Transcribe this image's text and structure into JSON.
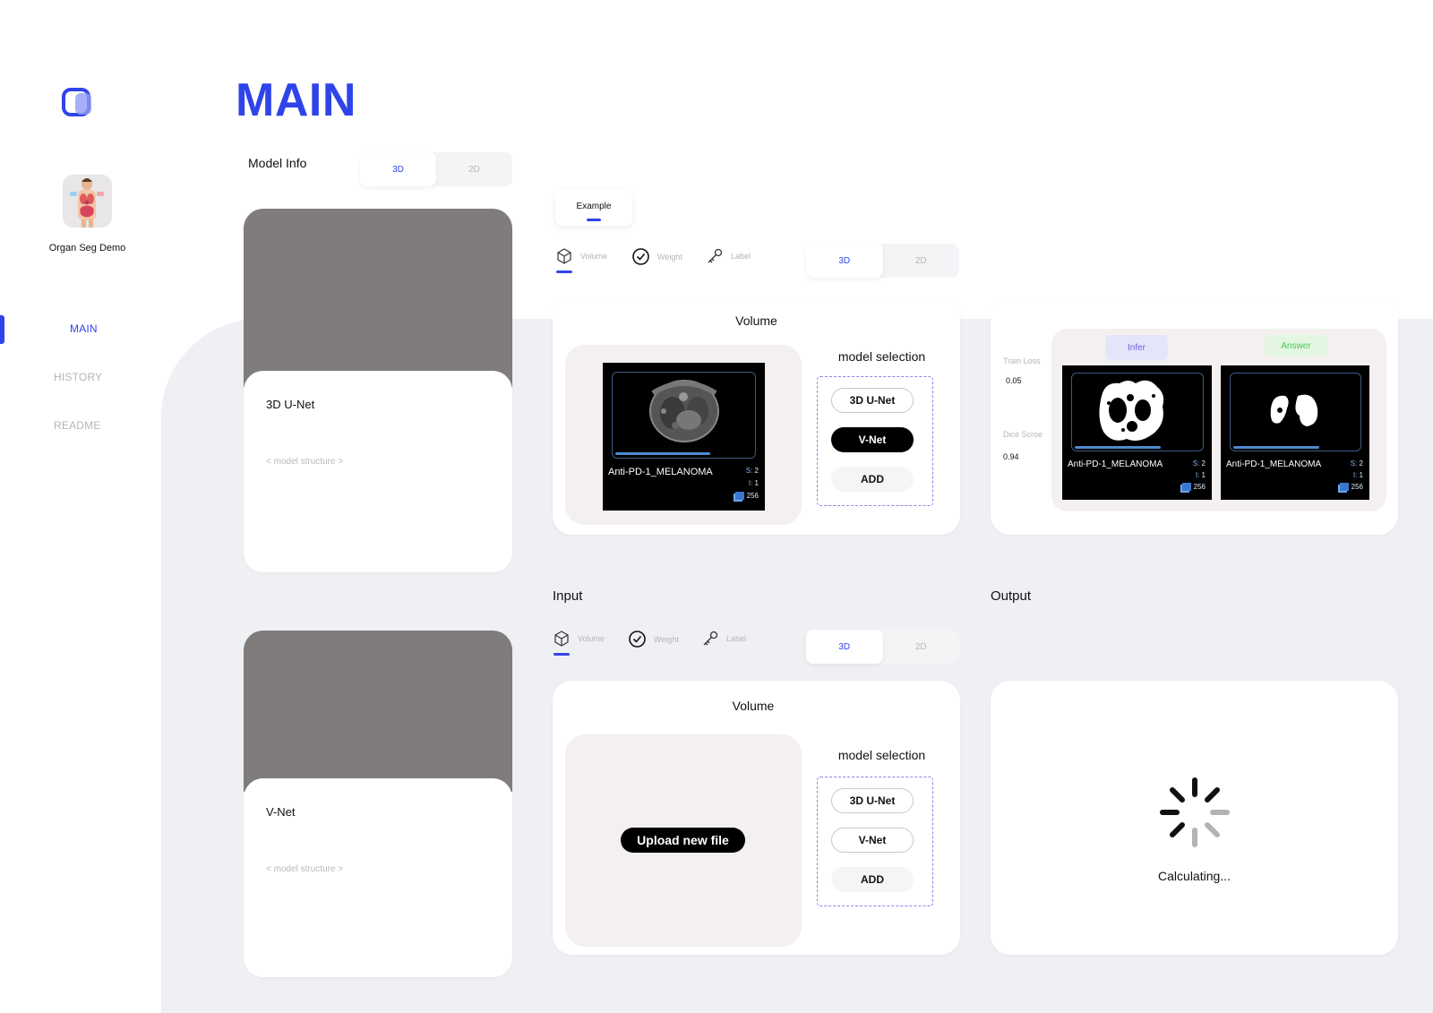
{
  "app": {
    "name": "Organ Seg Demo",
    "page_title": "MAIN",
    "accent_color": "#2f44e8"
  },
  "sidebar": {
    "items": [
      {
        "label": "MAIN",
        "active": true
      },
      {
        "label": "HISTORY",
        "active": false
      },
      {
        "label": "README",
        "active": false
      }
    ]
  },
  "model_info": {
    "label": "Model Info",
    "toggle": {
      "options": [
        "3D",
        "2D"
      ],
      "selected": "3D"
    },
    "cards": [
      {
        "name": "3D U-Net",
        "structure_placeholder": "< model structure >"
      },
      {
        "name": "V-Net",
        "structure_placeholder": "< model structure >"
      }
    ]
  },
  "example": {
    "tab_label": "Example",
    "icon_tabs": [
      {
        "label": "Volume",
        "icon": "cube-icon",
        "active": true
      },
      {
        "label": "Weight",
        "icon": "check-circle-icon",
        "active": false
      },
      {
        "label": "Label",
        "icon": "key-icon",
        "active": false
      }
    ],
    "toggle": {
      "options": [
        "3D",
        "2D"
      ],
      "selected": "3D"
    },
    "volume_panel": {
      "title": "Volume",
      "scan": {
        "name": "Anti-PD-1_MELANOMA",
        "s_label": "S:",
        "s_value": "2",
        "i_label": "I:",
        "i_value": "1",
        "count": "256"
      },
      "model_selection": {
        "title": "model selection",
        "options": [
          "3D U-Net",
          "V-Net"
        ],
        "selected": "V-Net",
        "add_label": "ADD"
      }
    },
    "result_panel": {
      "metrics": [
        {
          "label": "Train Loss",
          "value": "0.05"
        },
        {
          "label": "Dice Scroe",
          "value": "0.94"
        }
      ],
      "infer_label": "Infer",
      "answer_label": "Answer",
      "scans": [
        {
          "name": "Anti-PD-1_MELANOMA",
          "s_label": "S:",
          "s_value": "2",
          "i_label": "I:",
          "i_value": "1",
          "count": "256"
        },
        {
          "name": "Anti-PD-1_MELANOMA",
          "s_label": "S:",
          "s_value": "2",
          "i_label": "I:",
          "i_value": "1",
          "count": "256"
        }
      ]
    }
  },
  "input": {
    "label": "Input",
    "icon_tabs": [
      {
        "label": "Volume",
        "icon": "cube-icon",
        "active": true
      },
      {
        "label": "Weight",
        "icon": "check-circle-icon",
        "active": false
      },
      {
        "label": "Label",
        "icon": "key-icon",
        "active": false
      }
    ],
    "toggle": {
      "options": [
        "3D",
        "2D"
      ],
      "selected": "3D"
    },
    "volume_panel": {
      "title": "Volume",
      "upload_label": "Upload new file",
      "model_selection": {
        "title": "model selection",
        "options": [
          "3D U-Net",
          "V-Net"
        ],
        "selected": "",
        "add_label": "ADD"
      }
    }
  },
  "output": {
    "label": "Output",
    "status_text": "Calculating...",
    "status_icon": "spinner-icon"
  }
}
